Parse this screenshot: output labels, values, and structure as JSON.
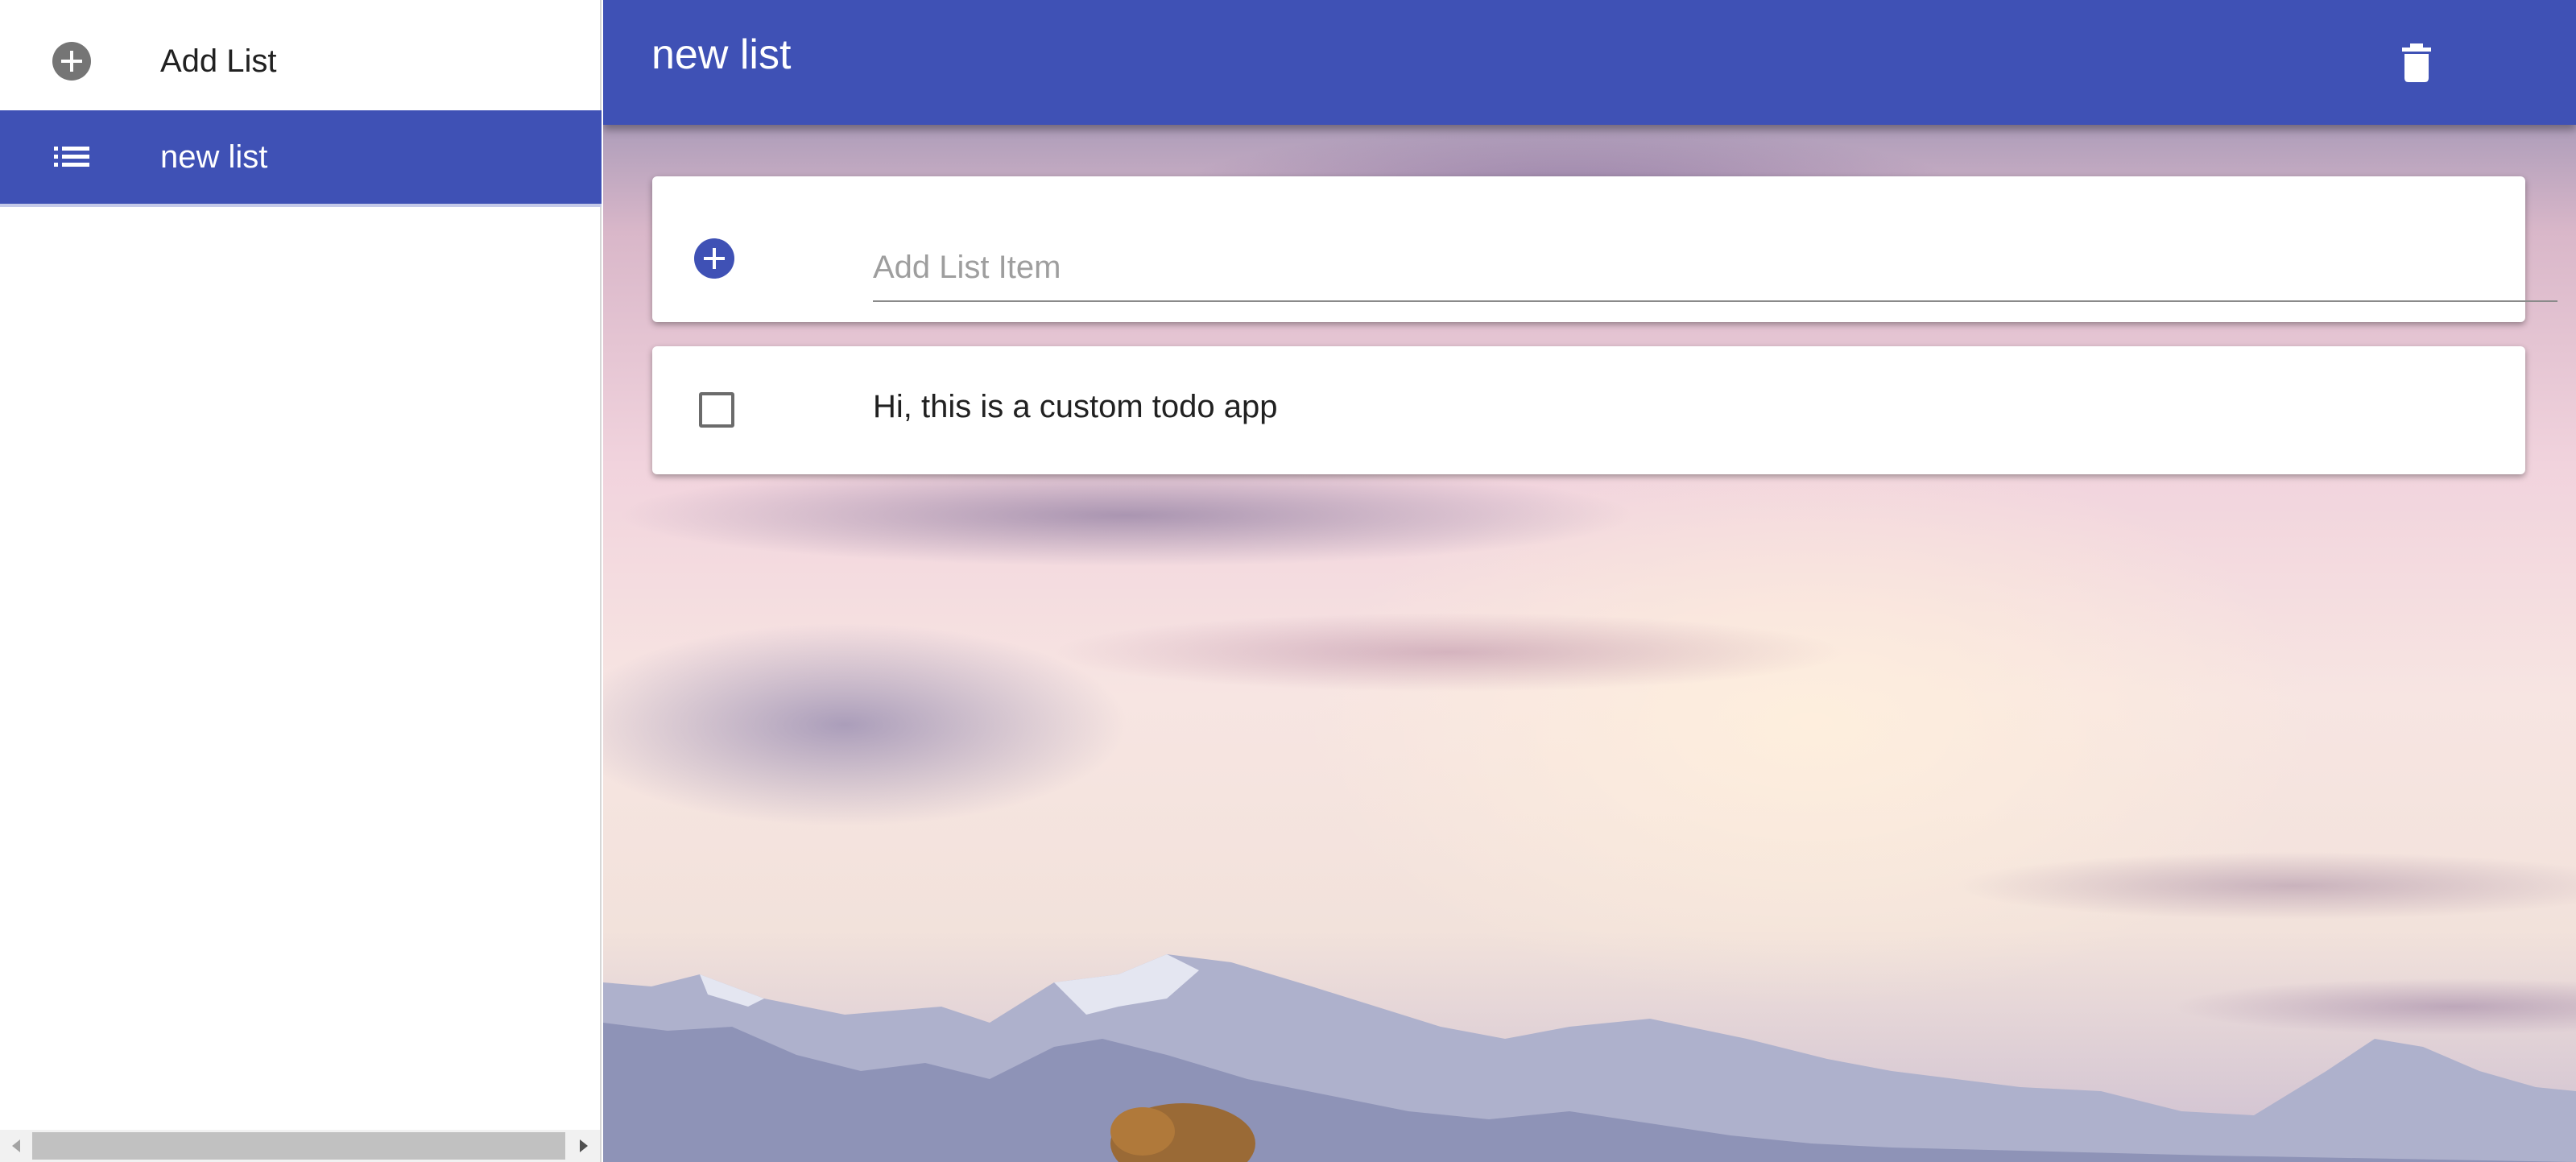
{
  "sidebar": {
    "add_list_label": "Add List",
    "lists": [
      {
        "label": "new list",
        "active": true,
        "icon": "list-icon"
      }
    ],
    "add_icon": "add-circle-icon"
  },
  "header": {
    "title": "new list",
    "delete_icon": "trash-icon"
  },
  "add_item": {
    "placeholder": "Add List Item",
    "value": "",
    "icon": "add-circle-icon"
  },
  "items": [
    {
      "text": "Hi, this is a custom todo app",
      "checked": false
    }
  ],
  "colors": {
    "primary": "#3f51b5",
    "sidebar_bg": "#ffffff",
    "text": "#212121",
    "icon_gray": "#757575"
  }
}
